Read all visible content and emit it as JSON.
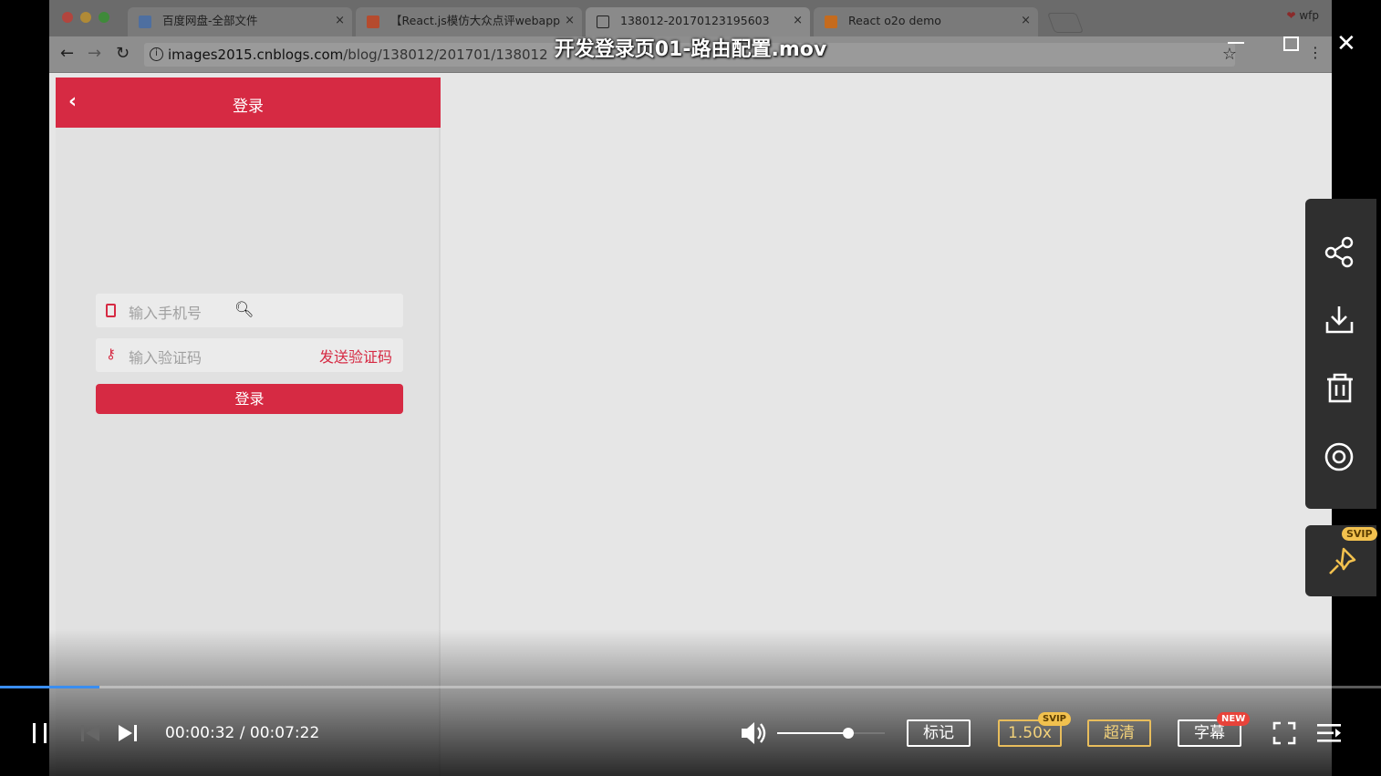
{
  "browser": {
    "tabs": [
      {
        "title": "百度网盘-全部文件",
        "close": "×"
      },
      {
        "title": "【React.js模仿大众点评webapp",
        "close": "×"
      },
      {
        "title": "138012-20170123195603",
        "close": "×"
      },
      {
        "title": "React o2o demo",
        "close": "×"
      }
    ],
    "profile": "wfp",
    "address": {
      "host": "images2015.cnblogs.com",
      "path": "/blog/138012/201701/138012"
    }
  },
  "app": {
    "header_title": "登录",
    "phone_placeholder": "输入手机号",
    "code_placeholder": "输入验证码",
    "send_code": "发送验证码",
    "login_button": "登录"
  },
  "player": {
    "title": "开发登录页01-路由配置.mov",
    "current_time": "00:00:32",
    "total_time": "00:07:22",
    "progress_fraction": 0.072,
    "volume_fraction": 0.66,
    "buttons": {
      "mark": "标记",
      "speed": "1.50x",
      "speed_badge": "SVIP",
      "quality": "超清",
      "subtitle": "字幕",
      "subtitle_badge": "NEW",
      "pin_badge": "SVIP"
    },
    "colors": {
      "accent": "#3a8ef0",
      "brand_red": "#d62a43",
      "svip_gold": "#f2c14e",
      "new_red": "#e8433a"
    }
  }
}
